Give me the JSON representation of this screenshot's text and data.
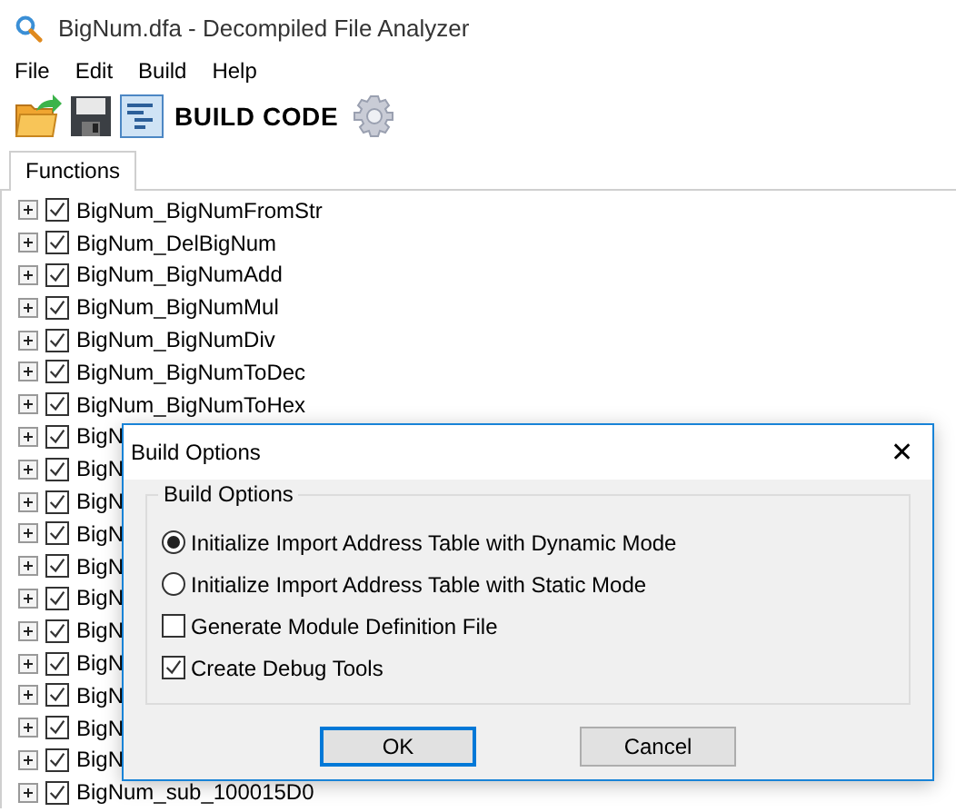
{
  "window": {
    "title": "BigNum.dfa - Decompiled File Analyzer"
  },
  "menu": [
    "File",
    "Edit",
    "Build",
    "Help"
  ],
  "toolbar": {
    "label": "BUILD CODE"
  },
  "tabs": [
    {
      "label": "Functions",
      "selected": true
    }
  ],
  "tree": [
    {
      "label": "BigNum_BigNumFromStr",
      "checked": true,
      "expanded": false
    },
    {
      "label": "BigNum_DelBigNum",
      "checked": true,
      "expanded": false
    },
    {
      "label": "BigNum_BigNumAdd",
      "checked": true,
      "expanded": false
    },
    {
      "label": "BigNum_BigNumMul",
      "checked": true,
      "expanded": false
    },
    {
      "label": "BigNum_BigNumDiv",
      "checked": true,
      "expanded": false
    },
    {
      "label": "BigNum_BigNumToDec",
      "checked": true,
      "expanded": false
    },
    {
      "label": "BigNum_BigNumToHex",
      "checked": true,
      "expanded": false
    },
    {
      "label": "BigN",
      "checked": true,
      "expanded": false
    },
    {
      "label": "BigN",
      "checked": true,
      "expanded": false
    },
    {
      "label": "BigN",
      "checked": true,
      "expanded": false
    },
    {
      "label": "BigN",
      "checked": true,
      "expanded": false
    },
    {
      "label": "BigN",
      "checked": true,
      "expanded": false
    },
    {
      "label": "BigN",
      "checked": true,
      "expanded": false
    },
    {
      "label": "BigN",
      "checked": true,
      "expanded": false
    },
    {
      "label": "BigN",
      "checked": true,
      "expanded": false
    },
    {
      "label": "BigN",
      "checked": true,
      "expanded": false
    },
    {
      "label": "BigN",
      "checked": true,
      "expanded": false
    },
    {
      "label": "BigN",
      "checked": true,
      "expanded": false
    },
    {
      "label": "BigNum_sub_100015D0",
      "checked": true,
      "expanded": false
    }
  ],
  "dialog": {
    "title": "Build Options",
    "close": "✕",
    "group_title": "Build Options",
    "options": [
      {
        "kind": "radio",
        "label": "Initialize Import Address Table with Dynamic Mode",
        "selected": true
      },
      {
        "kind": "radio",
        "label": "Initialize Import Address Table with Static Mode",
        "selected": false
      },
      {
        "kind": "checkbox",
        "label": "Generate Module Definition File",
        "checked": false
      },
      {
        "kind": "checkbox",
        "label": "Create Debug Tools",
        "checked": true
      }
    ],
    "buttons": [
      {
        "label": "OK",
        "default": true
      },
      {
        "label": "Cancel",
        "default": false
      }
    ]
  }
}
